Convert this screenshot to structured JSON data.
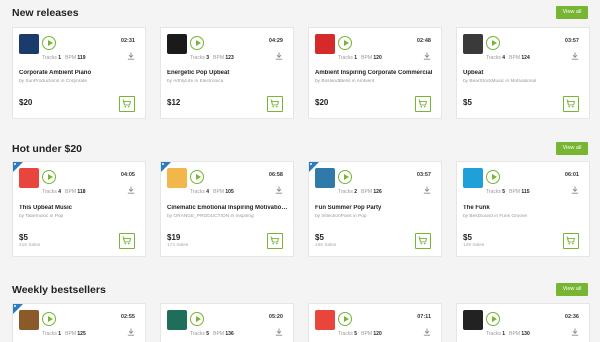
{
  "sections": [
    {
      "title": "New releases",
      "view_all": "View all",
      "cards": [
        {
          "duration": "02:31",
          "tracks_label": "Tracks",
          "tracks": "1",
          "bpm_label": "BPM",
          "bpm": "119",
          "title": "Corporate Ambient Piano",
          "by": "by",
          "author": "SunProductions",
          "in": "in",
          "category": "Corporate",
          "price": "$20",
          "thumb": "globe-logo",
          "thumb_color": "#1b3c6b"
        },
        {
          "duration": "04:29",
          "tracks_label": "Tracks",
          "tracks": "3",
          "bpm_label": "BPM",
          "bpm": "123",
          "title": "Energetic Pop Upbeat",
          "by": "by",
          "author": "ArthlyLife",
          "in": "in",
          "category": "Electronica",
          "price": "$12",
          "thumb": "headphones-logo",
          "thumb_color": "#1a1a1a"
        },
        {
          "duration": "02:48",
          "tracks_label": "Tracks",
          "tracks": "1",
          "bpm_label": "BPM",
          "bpm": "120",
          "title": "Ambient Inspiring Corporate Commercial",
          "by": "by",
          "author": "BoslandBless",
          "in": "in",
          "category": "Ambient",
          "price": "$20",
          "thumb": "red-round-logo",
          "thumb_color": "#d42a2a"
        },
        {
          "duration": "03:57",
          "tracks_label": "Tracks",
          "tracks": "4",
          "bpm_label": "BPM",
          "bpm": "124",
          "title": "Upbeat",
          "by": "by",
          "author": "BearStockMusic",
          "in": "in",
          "category": "Motivational",
          "price": "$5",
          "thumb": "bear-logo",
          "thumb_color": "#3a3a3a"
        }
      ]
    },
    {
      "title": "Hot under $20",
      "view_all": "View all",
      "cards": [
        {
          "duration": "04:05",
          "tracks_label": "Tracks",
          "tracks": "4",
          "bpm_label": "BPM",
          "bpm": "118",
          "title": "This Upbeat Music",
          "by": "by",
          "author": "Tabemusic",
          "in": "in",
          "category": "Pop",
          "price": "$5",
          "sales": "216 Sales",
          "thumb": "red-tile-logo",
          "thumb_color": "#e8453c"
        },
        {
          "duration": "06:58",
          "tracks_label": "Tracks",
          "tracks": "4",
          "bpm_label": "BPM",
          "bpm": "105",
          "title": "Cinematic Emotional Inspiring Motivational",
          "by": "by",
          "author": "ORANGE_PRODUCTION",
          "in": "in",
          "category": "Inspiring",
          "price": "$19",
          "sales": "173 Sales",
          "thumb": "cake-logo",
          "thumb_color": "#f2b64a"
        },
        {
          "duration": "03:57",
          "tracks_label": "Tracks",
          "tracks": "2",
          "bpm_label": "BPM",
          "bpm": "126",
          "title": "Fun Summer Pop Party",
          "by": "by",
          "author": "InflectionPoint",
          "in": "in",
          "category": "Pop",
          "price": "$5",
          "sales": "166 Sales",
          "thumb": "diamond-logo",
          "thumb_color": "#2f7aa8"
        },
        {
          "duration": "06:01",
          "tracks_label": "Tracks",
          "tracks": "5",
          "bpm_label": "BPM",
          "bpm": "115",
          "title": "The Funk",
          "by": "by",
          "author": "BestSound",
          "in": "in",
          "category": "Funk Groove",
          "price": "$5",
          "sales": "139 Sales",
          "thumb": "triangle-logo",
          "thumb_color": "#1fa0d8"
        }
      ]
    },
    {
      "title": "Weekly bestsellers",
      "view_all": "View all",
      "cards": [
        {
          "duration": "02:55",
          "tracks_label": "Tracks",
          "tracks": "1",
          "bpm_label": "BPM",
          "bpm": "125",
          "thumb": "wreath-logo",
          "thumb_color": "#8a5a2b"
        },
        {
          "duration": "05:20",
          "tracks_label": "Tracks",
          "tracks": "5",
          "bpm_label": "BPM",
          "bpm": "136",
          "thumb": "green-grid-logo",
          "thumb_color": "#1f6e5a"
        },
        {
          "duration": "07:11",
          "tracks_label": "Tracks",
          "tracks": "5",
          "bpm_label": "BPM",
          "bpm": "120",
          "thumb": "red-hexagon-logo",
          "thumb_color": "#e8453c"
        },
        {
          "duration": "02:36",
          "tracks_label": "Tracks",
          "tracks": "1",
          "bpm_label": "BPM",
          "bpm": "130",
          "thumb": "monkey-logo",
          "thumb_color": "#222222"
        }
      ]
    }
  ],
  "colors": {
    "accent": "#77b533",
    "ribbon": "#2a7bbf"
  }
}
